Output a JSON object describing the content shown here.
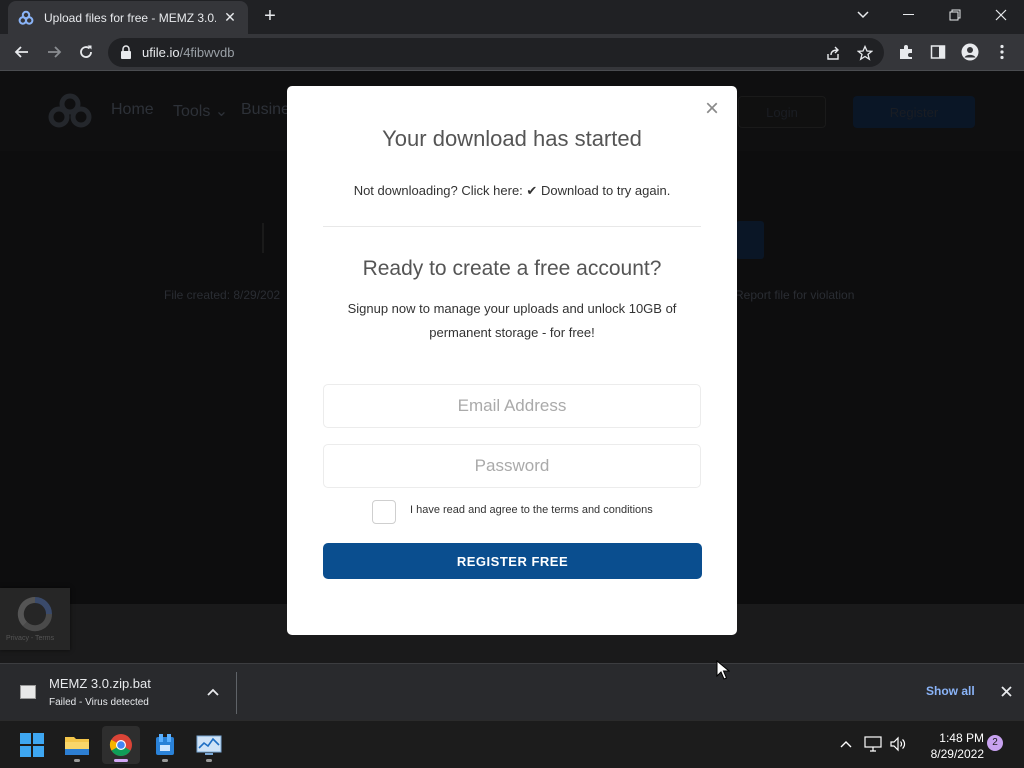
{
  "browser": {
    "tab_title": "Upload files for free - MEMZ 3.0.",
    "url_host": "ufile.io",
    "url_path": "/4fibwvdb"
  },
  "site": {
    "nav": [
      "Home",
      "Tools",
      "Busine"
    ],
    "login_label": "Login",
    "register_label": "Register",
    "file_created": "File created: 8/29/202",
    "report_link": "Report file for violation",
    "recaptcha_links": "Privacy - Terms"
  },
  "modal": {
    "title": "Your download has started",
    "retry_prefix": "Not downloading? Click here:",
    "retry_link": "Download to try again.",
    "signup_title": "Ready to create a free account?",
    "signup_desc": "Signup now to manage your uploads and unlock 10GB of permanent storage - for free!",
    "email_placeholder": "Email Address",
    "password_placeholder": "Password",
    "terms_label": "I have read and agree to the terms and conditions",
    "register_button": "REGISTER FREE"
  },
  "downloads": {
    "file_name": "MEMZ 3.0.zip.bat",
    "status": "Failed - Virus detected",
    "show_all": "Show all"
  },
  "taskbar": {
    "time": "1:48 PM",
    "date": "8/29/2022",
    "notification_count": "2"
  },
  "colors": {
    "accent_blue": "#0a4e8f",
    "chrome_dark": "#202124",
    "link_blue": "#8ab4f8"
  }
}
